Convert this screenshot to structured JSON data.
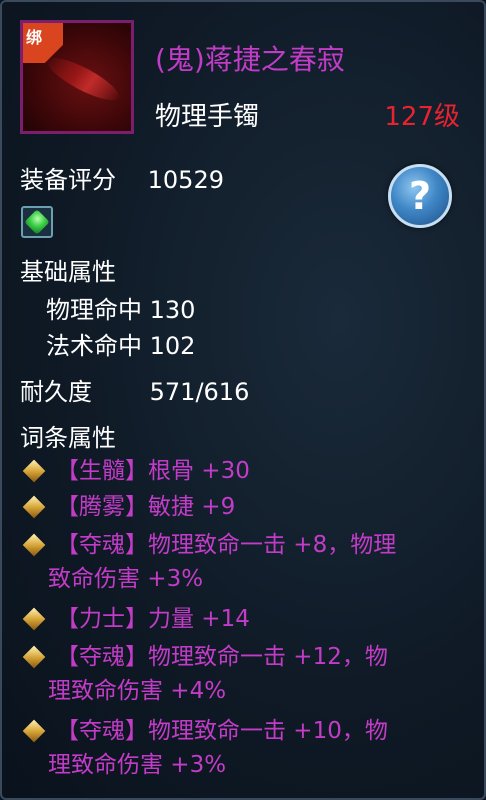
{
  "item": {
    "bind_tag": "绑",
    "name": "(鬼)蒋捷之春寂",
    "type": "物理手镯",
    "level": "127级"
  },
  "score": {
    "label": "装备评分",
    "value": "10529"
  },
  "help": {
    "label": "?"
  },
  "base": {
    "title": "基础属性",
    "stats": [
      {
        "label": "物理命中",
        "value": "130"
      },
      {
        "label": "法术命中",
        "value": "102"
      }
    ]
  },
  "durability": {
    "label": "耐久度",
    "value": "571/616"
  },
  "affixes": {
    "title": "词条属性",
    "items": [
      {
        "line1": "【生髓】根骨 +30",
        "line2": ""
      },
      {
        "line1": "【腾雾】敏捷 +9",
        "line2": ""
      },
      {
        "line1": "【夺魂】物理致命一击 +8，物理",
        "line2": "致命伤害 +3%"
      },
      {
        "line1": "【力士】力量 +14",
        "line2": ""
      },
      {
        "line1": "【夺魂】物理致命一击 +12，物",
        "line2": "理致命伤害 +4%"
      },
      {
        "line1": "【夺魂】物理致命一击 +10，物",
        "line2": "理致命伤害 +3%"
      }
    ]
  },
  "colors": {
    "name": "#c23cc8",
    "level": "#e8232f",
    "affix": "#c23cc8",
    "text": "#ffffff"
  }
}
